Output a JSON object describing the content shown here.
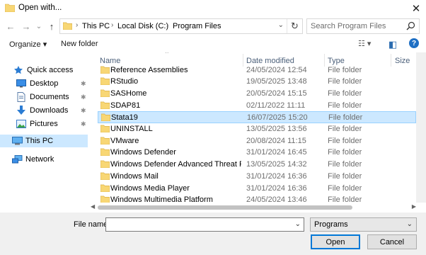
{
  "window": {
    "title": "Open with...",
    "close_glyph": "✕"
  },
  "nav_buttons": {
    "back": "←",
    "forward": "→",
    "recent": "⌄",
    "up": "↑"
  },
  "address": {
    "crumbs": [
      "This PC",
      "Local Disk (C:)",
      "Program Files"
    ],
    "separator": "›",
    "dropdown": "⌄",
    "refresh": "↻"
  },
  "search": {
    "placeholder": "Search Program Files"
  },
  "toolbar": {
    "organize_label": "Organize ▾",
    "new_folder_label": "New folder",
    "view_glyph": "☷ ▾",
    "pane_glyph": "◧",
    "help_glyph": "?"
  },
  "nav_pane": {
    "quick_access": "Quick access",
    "items": [
      {
        "label": "Desktop",
        "pinned": true
      },
      {
        "label": "Documents",
        "pinned": true
      },
      {
        "label": "Downloads",
        "pinned": true
      },
      {
        "label": "Pictures",
        "pinned": true
      }
    ],
    "this_pc": "This PC",
    "network": "Network",
    "pin_glyph": "📌"
  },
  "columns": {
    "name": "Name",
    "date": "Date modified",
    "type": "Type",
    "size": "Size",
    "sort_glyph": "^"
  },
  "files": [
    {
      "name": "Reference Assemblies",
      "date": "24/05/2024 12:54",
      "type": "File folder"
    },
    {
      "name": "RStudio",
      "date": "19/05/2025 13:48",
      "type": "File folder"
    },
    {
      "name": "SASHome",
      "date": "20/05/2024 15:15",
      "type": "File folder"
    },
    {
      "name": "SDAP81",
      "date": "02/11/2022 11:11",
      "type": "File folder"
    },
    {
      "name": "Stata19",
      "date": "16/07/2025 15:20",
      "type": "File folder",
      "selected": true
    },
    {
      "name": "UNINSTALL",
      "date": "13/05/2025 13:56",
      "type": "File folder"
    },
    {
      "name": "VMware",
      "date": "20/08/2024 11:15",
      "type": "File folder"
    },
    {
      "name": "Windows Defender",
      "date": "31/01/2024 16:45",
      "type": "File folder"
    },
    {
      "name": "Windows Defender Advanced Threat Prot...",
      "date": "13/05/2025 14:32",
      "type": "File folder"
    },
    {
      "name": "Windows Mail",
      "date": "31/01/2024 16:36",
      "type": "File folder"
    },
    {
      "name": "Windows Media Player",
      "date": "31/01/2024 16:36",
      "type": "File folder"
    },
    {
      "name": "Windows Multimedia Platform",
      "date": "24/05/2024 13:46",
      "type": "File folder"
    }
  ],
  "bottom": {
    "file_name_label": "File name:",
    "file_name_value": "",
    "filter_value": "Programs",
    "open_label": "Open",
    "cancel_label": "Cancel"
  },
  "colors": {
    "accent": "#0078d7",
    "selection": "#cce8ff",
    "folder": "#f8d775"
  }
}
